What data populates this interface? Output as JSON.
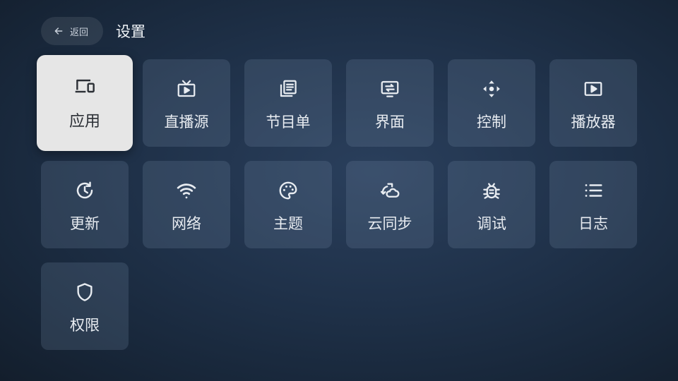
{
  "header": {
    "back_label": "返回",
    "title": "设置"
  },
  "tiles": [
    {
      "label": "应用",
      "icon": "devices-icon",
      "focused": true
    },
    {
      "label": "直播源",
      "icon": "live-tv-icon"
    },
    {
      "label": "节目单",
      "icon": "library-icon"
    },
    {
      "label": "界面",
      "icon": "screen-icon"
    },
    {
      "label": "控制",
      "icon": "dpad-icon"
    },
    {
      "label": "播放器",
      "icon": "play-box-icon"
    },
    {
      "label": "更新",
      "icon": "update-icon"
    },
    {
      "label": "网络",
      "icon": "wifi-icon"
    },
    {
      "label": "主题",
      "icon": "palette-icon"
    },
    {
      "label": "云同步",
      "icon": "cloud-sync-icon"
    },
    {
      "label": "调试",
      "icon": "bug-icon"
    },
    {
      "label": "日志",
      "icon": "list-icon"
    },
    {
      "label": "权限",
      "icon": "shield-icon"
    }
  ],
  "colors": {
    "focused_tile": "#e6e6e6",
    "tile": "#33465e",
    "background": "#1f3149"
  }
}
